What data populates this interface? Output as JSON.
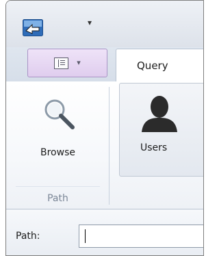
{
  "quick_access": {
    "icon": "pointer-arrow-icon",
    "customize_arrow": "▾"
  },
  "ribbon": {
    "application_button": {
      "icon": "panel-layout-icon",
      "caret": "▾"
    },
    "tabs": [
      {
        "label": "Query",
        "selected": true
      }
    ],
    "groups": [
      {
        "label": "Path",
        "buttons": [
          {
            "label": "Browse",
            "icon": "magnifier-icon"
          }
        ]
      },
      {
        "label": "",
        "buttons": [
          {
            "label": "Users",
            "icon": "user-silhouette-icon"
          }
        ]
      }
    ]
  },
  "pathbar": {
    "label": "Path:",
    "value": ""
  },
  "colors": {
    "accent_purple": "#dfcdee",
    "ribbon_blue": "#d6dee9"
  }
}
